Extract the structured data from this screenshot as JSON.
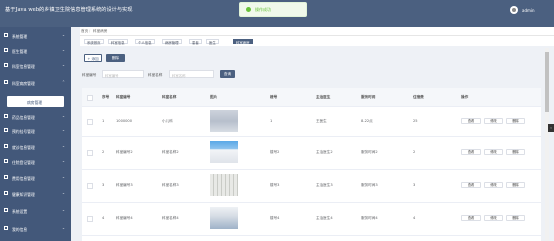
{
  "app": {
    "title": "基于Java web的乡镇卫生院信息管理系统的设计与实现",
    "username": "admin"
  },
  "toast": {
    "message": "操作成功"
  },
  "sidebar": {
    "items": [
      {
        "label": "系统管理"
      },
      {
        "label": "医生管理"
      },
      {
        "label": "科室信息管理"
      },
      {
        "label": "科室病房管理"
      },
      {
        "label": "药品信息管理"
      },
      {
        "label": "预约挂号管理"
      },
      {
        "label": "就诊信息管理"
      },
      {
        "label": "住院登记管理"
      },
      {
        "label": "费用信息管理"
      },
      {
        "label": "健康知识管理"
      },
      {
        "label": "系统设置"
      },
      {
        "label": "我的信息"
      }
    ],
    "active_sub": "病房管理"
  },
  "breadcrumb": {
    "home": "首页",
    "current": "科室病房"
  },
  "tags": [
    "系统首页",
    "科室信息",
    "个人信息",
    "病房管理",
    "患者",
    "医生",
    "科室病房"
  ],
  "toolbar": {
    "add_label": "+ 添加",
    "delete_label": "删除"
  },
  "search": {
    "fields": [
      {
        "label": "科室编号",
        "placeholder": "科室编号"
      },
      {
        "label": "科室名称",
        "placeholder": "科室名称"
      }
    ],
    "button_label": "查询"
  },
  "table": {
    "headers": [
      "",
      "序号",
      "科室编号",
      "科室名称",
      "图片",
      "楼号",
      "主治医生",
      "服务时间",
      "住宿费",
      "操作"
    ],
    "rows": [
      {
        "index": "1",
        "code": "1000000",
        "name": "小儿科",
        "building": "1",
        "doctor": "王医生",
        "service": "8-22点",
        "fee": "25"
      },
      {
        "index": "2",
        "code": "科室编号2",
        "name": "科室名称2",
        "building": "楼号2",
        "doctor": "主治医生2",
        "service": "服务时间2",
        "fee": "2"
      },
      {
        "index": "3",
        "code": "科室编号3",
        "name": "科室名称3",
        "building": "楼号3",
        "doctor": "主治医生3",
        "service": "服务时间3",
        "fee": "3"
      },
      {
        "index": "4",
        "code": "科室编号4",
        "name": "科室名称4",
        "building": "楼号4",
        "doctor": "主治医生4",
        "service": "服务时间4",
        "fee": "4"
      }
    ],
    "actions": {
      "view": "查看",
      "edit": "修改",
      "delete": "删除"
    }
  },
  "colors": {
    "primary": "#4b6080",
    "sidebar": "#43587a",
    "success": "#67c23a"
  }
}
